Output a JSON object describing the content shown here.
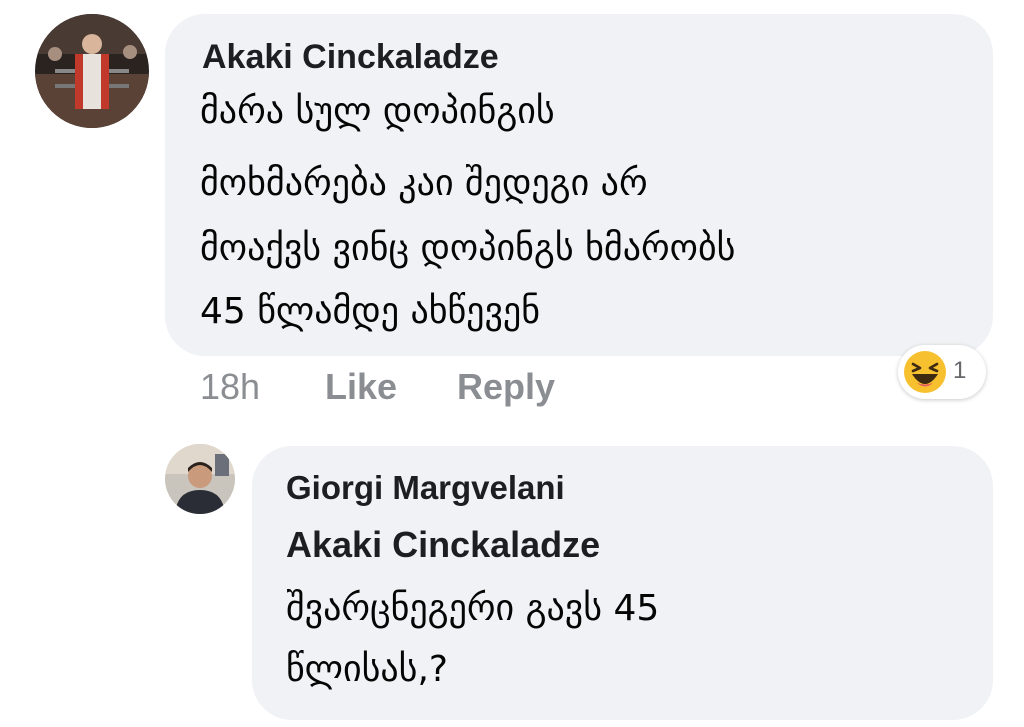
{
  "comments": [
    {
      "author": "Akaki Cinckaladze",
      "lines": [
        "მარა სულ დოპინგის",
        "მოხმარება კაი შედეგი არ",
        "მოაქვს ვინც დოპინგს ხმარობს",
        "45 წლამდე ახწევენ"
      ],
      "time": "18h",
      "like_label": "Like",
      "reply_label": "Reply",
      "reaction": {
        "icon": "laughing-emoji-icon",
        "count": "1"
      }
    }
  ],
  "reply": {
    "author": "Giorgi Margvelani",
    "mention": "Akaki Cinckaladze",
    "lines": [
      "შვარცნეგერი  გავს 45",
      "წლისას,?"
    ]
  },
  "colors": {
    "bubble": "#f0f2f5",
    "text": "#050505",
    "muted": "#8a8d91",
    "emoji": "#f7c02e"
  }
}
